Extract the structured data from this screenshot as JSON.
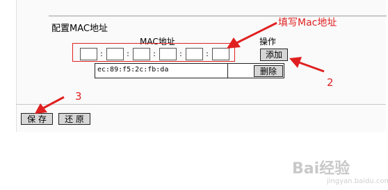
{
  "section": {
    "title": "配置MAC地址"
  },
  "table": {
    "mac_header": "MAC地址",
    "ops_header": "操作"
  },
  "mac_octets": [
    "",
    "",
    "",
    "",
    "",
    ""
  ],
  "separator": ":",
  "buttons": {
    "add": "添加",
    "delete": "删除",
    "save": "保 存",
    "restore": "还 原"
  },
  "entries": [
    {
      "mac": "ec:89:f5:2c:fb:da"
    }
  ],
  "annotations": {
    "fill_hint": "填写Mac地址",
    "step2": "2",
    "step3": "3"
  },
  "watermark": {
    "brand": "Bai经验",
    "url": "jingyan.baidu.com"
  },
  "colors": {
    "annotation_red": "#e02020",
    "button_gray": "#d6d6d6"
  }
}
